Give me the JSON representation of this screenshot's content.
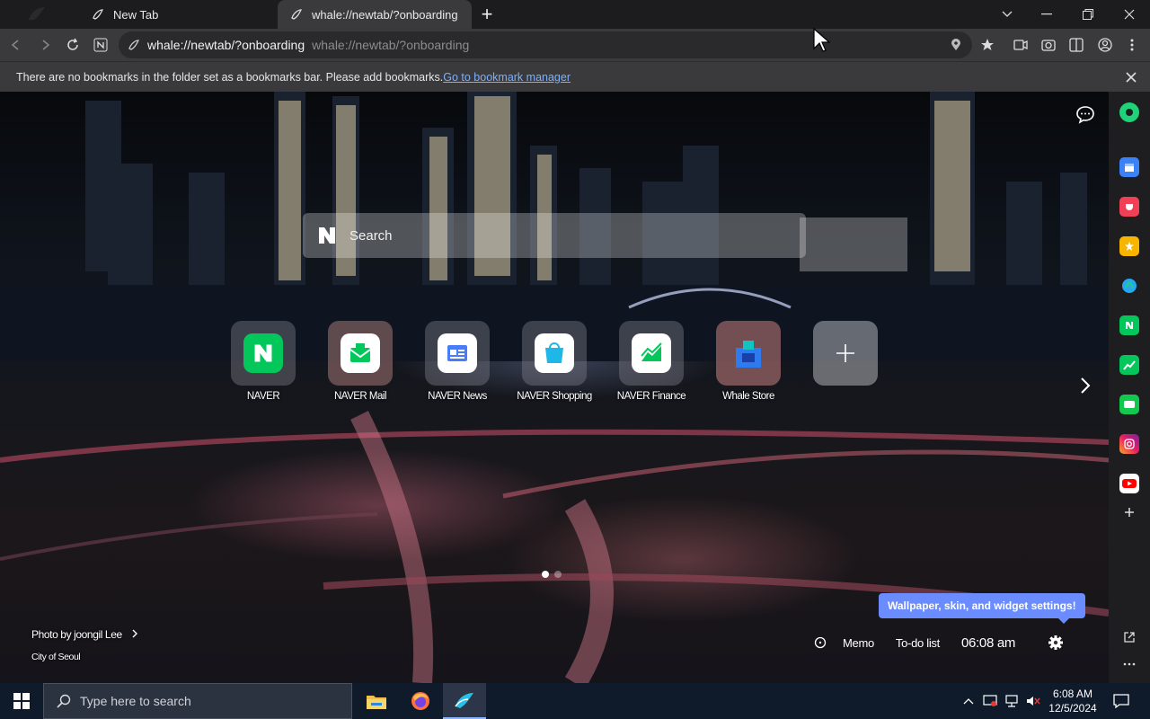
{
  "tabs": [
    {
      "title": "New Tab",
      "active": false
    },
    {
      "title": "whale://newtab/?onboarding",
      "active": true
    }
  ],
  "toolbar": {
    "url_main": "whale://newtab/?onboarding",
    "url_suggestion": "whale://newtab/?onboarding"
  },
  "bookmark_bar": {
    "message": "There are no bookmarks in the folder set as a bookmarks bar. Please add bookmarks.",
    "link": "Go to bookmark manager"
  },
  "search": {
    "placeholder": "Search"
  },
  "speed_dial": [
    {
      "label": "NAVER",
      "icon": "naver-icon",
      "color": "#03c75a"
    },
    {
      "label": "NAVER Mail",
      "icon": "naver-mail-icon",
      "color": "#03c75a"
    },
    {
      "label": "NAVER News",
      "icon": "naver-news-icon",
      "color": "#4a7cf7"
    },
    {
      "label": "NAVER Shopping",
      "icon": "naver-shopping-icon",
      "color": "#1fb6e8"
    },
    {
      "label": "NAVER Finance",
      "icon": "naver-finance-icon",
      "color": "#03c75a"
    },
    {
      "label": "Whale Store",
      "icon": "whale-store-icon",
      "color": "#2e7bf0"
    }
  ],
  "photo_credit": {
    "author": "Photo by joongil Lee",
    "location": "City of Seoul"
  },
  "tooltip": "Wallpaper, skin, and widget settings!",
  "widgets": {
    "memo": "Memo",
    "todo": "To-do list",
    "clock": "06:08 am"
  },
  "taskbar": {
    "search_placeholder": "Type here to search",
    "time": "6:08 AM",
    "date": "12/5/2024"
  },
  "colors": {
    "accent": "#6b8cff",
    "naver_green": "#03c75a"
  }
}
